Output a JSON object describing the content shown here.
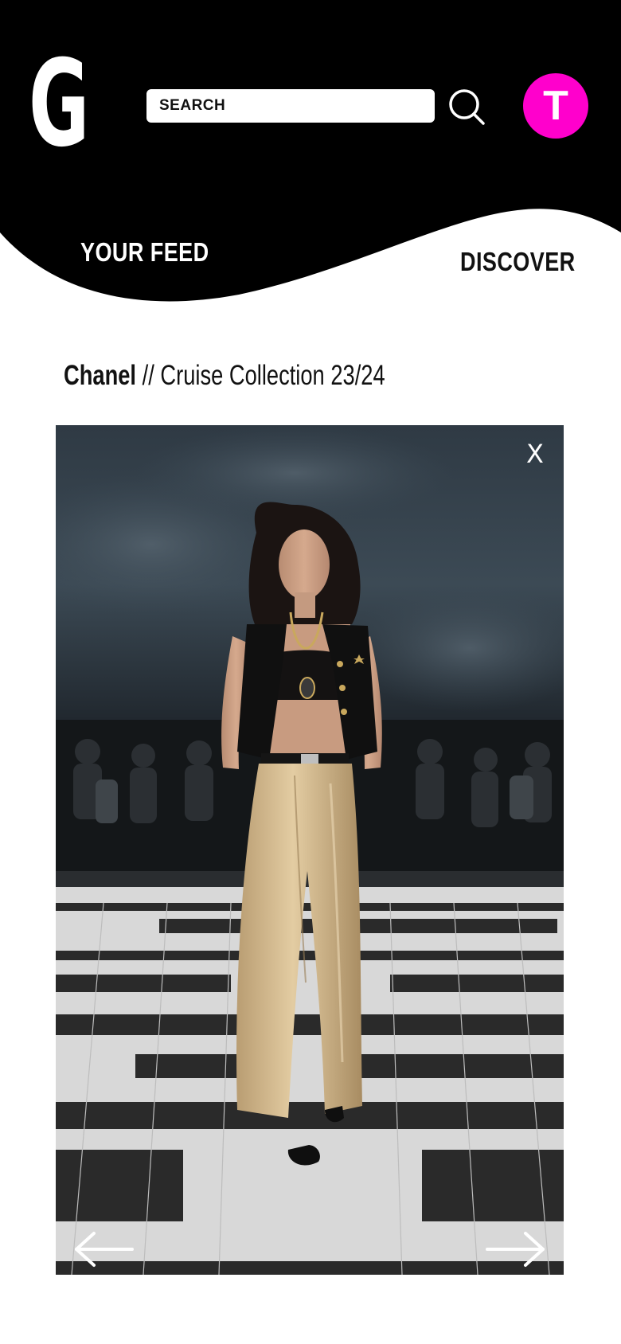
{
  "header": {
    "logo_letter": "G",
    "search": {
      "placeholder": "SEARCH",
      "value": ""
    },
    "avatar_initial": "T",
    "avatar_color": "#ff00cc",
    "background_color": "#000000"
  },
  "tabs": [
    {
      "label": "YOUR FEED",
      "active": true
    },
    {
      "label": "DISCOVER",
      "active": false
    }
  ],
  "collection": {
    "brand": "Chanel",
    "separator": "//",
    "name": "Cruise Collection 23/24"
  },
  "viewer": {
    "close_label": "X",
    "prev_icon": "arrow-left-icon",
    "next_icon": "arrow-right-icon"
  }
}
